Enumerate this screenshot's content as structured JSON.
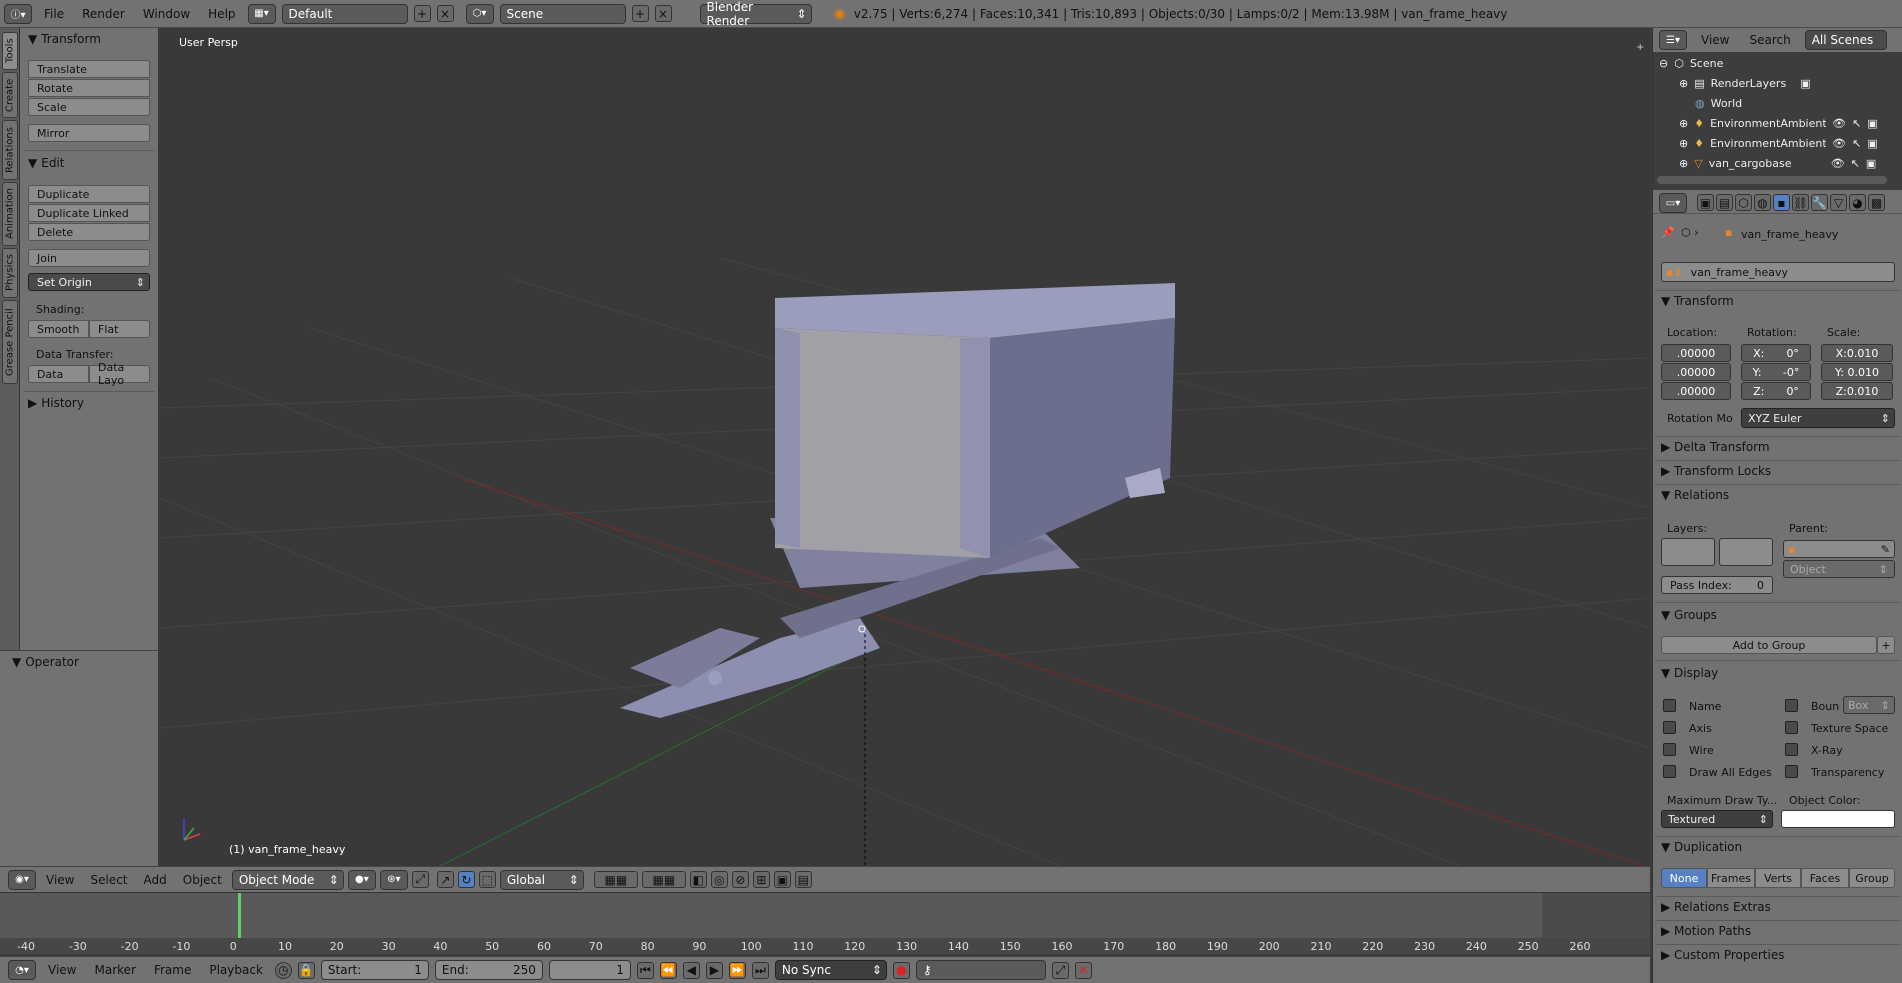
{
  "topbar": {
    "menus": [
      "File",
      "Render",
      "Window",
      "Help"
    ],
    "layout_field": "Default",
    "scene_field": "Scene",
    "engine": "Blender Render",
    "stats": "v2.75 | Verts:6,274 | Faces:10,341 | Tris:10,893 | Objects:0/30 | Lamps:0/2 | Mem:13.98M | van_frame_heavy"
  },
  "tabs": [
    "Tools",
    "Create",
    "Relations",
    "Animation",
    "Physics",
    "Grease Pencil"
  ],
  "toolshelf": {
    "transform_title": "Transform",
    "translate": "Translate",
    "rotate": "Rotate",
    "scale": "Scale",
    "mirror": "Mirror",
    "edit_title": "Edit",
    "duplicate": "Duplicate",
    "duplicate_linked": "Duplicate Linked",
    "delete": "Delete",
    "join": "Join",
    "set_origin": "Set Origin",
    "shading_label": "Shading:",
    "smooth": "Smooth",
    "flat": "Flat",
    "data_transfer_label": "Data Transfer:",
    "data": "Data",
    "data_layout": "Data Layo",
    "history_title": "History",
    "operator_title": "Operator"
  },
  "viewport": {
    "view_name": "User Persp",
    "object_label": "(1) van_frame_heavy"
  },
  "vpheader": {
    "menus": [
      "View",
      "Select",
      "Add",
      "Object"
    ],
    "mode": "Object Mode",
    "orientation": "Global"
  },
  "timeline": {
    "ticks": [
      "-40",
      "-30",
      "-20",
      "-10",
      "0",
      "10",
      "20",
      "30",
      "40",
      "50",
      "60",
      "70",
      "80",
      "90",
      "100",
      "110",
      "120",
      "130",
      "140",
      "150",
      "160",
      "170",
      "180",
      "190",
      "200",
      "210",
      "220",
      "230",
      "240",
      "250",
      "260"
    ],
    "menus": [
      "View",
      "Marker",
      "Frame",
      "Playback"
    ],
    "start_label": "Start:",
    "start_value": "1",
    "end_label": "End:",
    "end_value": "250",
    "current_frame": "1",
    "sync": "No Sync"
  },
  "outliner": {
    "view": "View",
    "search": "Search",
    "scenes": "All Scenes",
    "rows": [
      "Scene",
      "RenderLayers",
      "World",
      "EnvironmentAmbientLi",
      "EnvironmentAmbientLi",
      "van_cargobase"
    ]
  },
  "properties": {
    "breadcrumb": "van_frame_heavy",
    "object_name": "van_frame_heavy",
    "transform_title": "Transform",
    "location_label": "Location:",
    "rotation_label": "Rotation:",
    "scale_label": "Scale:",
    "location": [
      ".00000",
      ".00000",
      ".00000"
    ],
    "rotation": [
      {
        "axis": "X:",
        "value": "0°"
      },
      {
        "axis": "Y:",
        "value": "-0°"
      },
      {
        "axis": "Z:",
        "value": "0°"
      }
    ],
    "scale": [
      "X:0.010",
      "Y: 0.010",
      "Z:0.010"
    ],
    "rotation_mode_label": "Rotation Mo",
    "rotation_mode": "XYZ Euler",
    "delta_transform": "Delta Transform",
    "transform_locks": "Transform Locks",
    "relations_title": "Relations",
    "layers_label": "Layers:",
    "parent_label": "Parent:",
    "parent_type": "Object",
    "pass_index_label": "Pass Index:",
    "pass_index_value": "0",
    "groups_title": "Groups",
    "add_to_group": "Add to Group",
    "display_title": "Display",
    "display_left": [
      "Name",
      "Axis",
      "Wire",
      "Draw All Edges"
    ],
    "display_right": [
      "Boun",
      "Texture Space",
      "X-Ray",
      "Transparency"
    ],
    "bounds_type": "Box",
    "max_draw_label": "Maximum Draw Ty...",
    "object_color_label": "Object Color:",
    "max_draw_value": "Textured",
    "duplication_title": "Duplication",
    "duplication_options": [
      "None",
      "Frames",
      "Verts",
      "Faces",
      "Group"
    ],
    "relations_extras": "Relations Extras",
    "motion_paths": "Motion Paths",
    "custom_properties": "Custom Properties"
  },
  "colors": {
    "accent": "#5680c2",
    "frame_line": "#5fd35f",
    "mesh": "#8d8fb0"
  }
}
